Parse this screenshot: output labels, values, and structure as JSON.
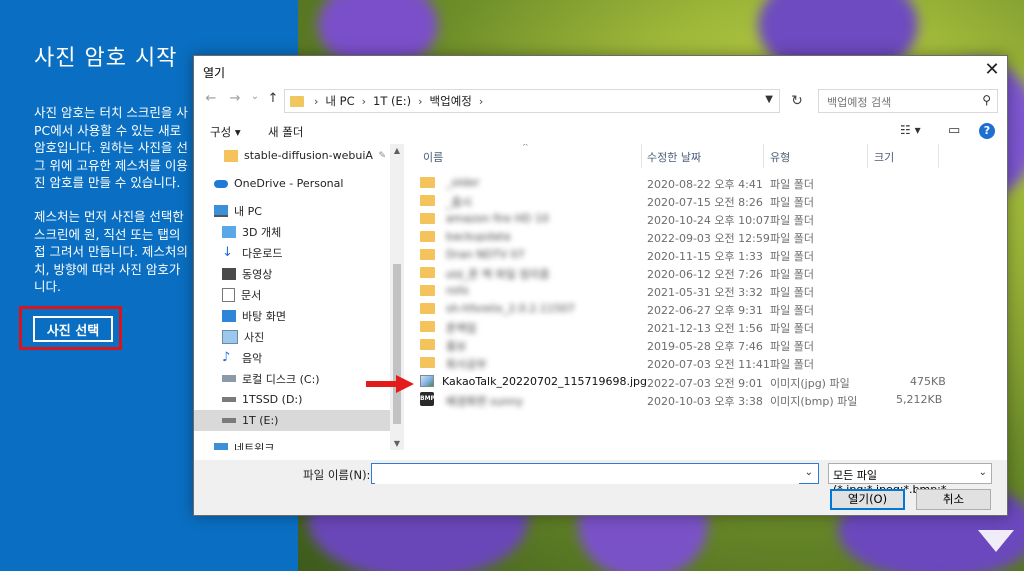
{
  "left_panel": {
    "title": "사진 암호 시작",
    "para1": "사진 암호는 터치 스크린을 사\nPC에서 사용할 수 있는 새로\n암호입니다. 원하는 사진을 선\n그 위에 고유한 제스처를 이용\n진 암호를 만들 수 있습니다.",
    "para2": "제스처는 먼저 사진을 선택한\n스크린에 원, 직선 또는 탭의\n접 그려서 만듭니다. 제스처의\n치, 방향에 따라 사진 암호가\n니다.",
    "button_label": "사진 선택"
  },
  "dialog": {
    "title": "열기",
    "close_symbol": "✕",
    "nav": {
      "back": "←",
      "forward": "→",
      "recent": "⌄",
      "up": "↑"
    },
    "breadcrumbs": [
      "내 PC",
      "1T (E:)",
      "백업예정"
    ],
    "breadcrumb_sep": "›",
    "refresh_symbol": "↻",
    "search_placeholder": "백업예정 검색",
    "toolbar": {
      "organize": "구성 ▾",
      "new_folder": "새 폴더",
      "view_symbol": "☷ ▾",
      "pane_symbol": "▭",
      "help": "?"
    },
    "nav_pane": [
      {
        "label": "stable-diffusion-webuiA",
        "icon": "folder-icon",
        "pin": "📌"
      },
      {
        "label": "OneDrive - Personal",
        "icon": "cloud-icon"
      },
      {
        "label": "내 PC",
        "icon": "pc-icon"
      },
      {
        "label": "3D 개체",
        "icon": "cube-icon"
      },
      {
        "label": "다운로드",
        "icon": "download-icon"
      },
      {
        "label": "동영상",
        "icon": "video-icon"
      },
      {
        "label": "문서",
        "icon": "document-icon"
      },
      {
        "label": "바탕 화면",
        "icon": "desktop-icon"
      },
      {
        "label": "사진",
        "icon": "picture-icon"
      },
      {
        "label": "음악",
        "icon": "music-icon"
      },
      {
        "label": "로컬 디스크 (C:)",
        "icon": "drive-icon"
      },
      {
        "label": "1TSSD (D:)",
        "icon": "drive-icon"
      },
      {
        "label": "1T (E:)",
        "icon": "drive-icon",
        "selected": true
      },
      {
        "label": "네트워크",
        "icon": "network-icon"
      }
    ],
    "columns": {
      "name": "이름",
      "date": "수정한 날짜",
      "type": "유형",
      "size": "크기"
    },
    "files": [
      {
        "name": "_older",
        "date": "2020-08-22 오후 4:41",
        "type": "파일 폴더",
        "size": "",
        "kind": "folder",
        "blurred": true
      },
      {
        "name": "_줌시",
        "date": "2020-07-15 오전 8:26",
        "type": "파일 폴더",
        "size": "",
        "kind": "folder",
        "blurred": true
      },
      {
        "name": "amazon fire HD 10",
        "date": "2020-10-24 오후 10:07",
        "type": "파일 폴더",
        "size": "",
        "kind": "folder",
        "blurred": true
      },
      {
        "name": "backupdata",
        "date": "2022-09-03 오전 12:59",
        "type": "파일 폴더",
        "size": "",
        "kind": "folder",
        "blurred": true
      },
      {
        "name": "Dran NDTV 07",
        "date": "2020-11-15 오후 1:33",
        "type": "파일 폴더",
        "size": "",
        "kind": "folder",
        "blurred": true
      },
      {
        "name": "old_폰 백 파일 정리중",
        "date": "2020-06-12 오전 7:26",
        "type": "파일 폴더",
        "size": "",
        "kind": "folder",
        "blurred": true
      },
      {
        "name": "rolls",
        "date": "2021-05-31 오전 3:32",
        "type": "파일 폴더",
        "size": "",
        "kind": "folder",
        "blurred": true
      },
      {
        "name": "sh-hfsrelix_2.0.2.11507",
        "date": "2022-06-27 오후 9:31",
        "type": "파일 폴더",
        "size": "",
        "kind": "folder",
        "blurred": true
      },
      {
        "name": "폰백업",
        "date": "2021-12-13 오전 1:56",
        "type": "파일 폴더",
        "size": "",
        "kind": "folder",
        "blurred": true
      },
      {
        "name": "홍보",
        "date": "2019-05-28 오후 7:46",
        "type": "파일 폴더",
        "size": "",
        "kind": "folder",
        "blurred": true
      },
      {
        "name": "회사공부",
        "date": "2020-07-03 오전 11:41",
        "type": "파일 폴더",
        "size": "",
        "kind": "folder",
        "blurred": true
      },
      {
        "name": "KakaoTalk_20220702_115719698.jpg",
        "date": "2022-07-03 오전 9:01",
        "type": "이미지(jpg) 파일",
        "size": "475KB",
        "kind": "jpg",
        "blurred": false
      },
      {
        "name": "배경화면 sunny",
        "date": "2020-10-03 오후 3:38",
        "type": "이미지(bmp) 파일",
        "size": "5,212KB",
        "kind": "bmp",
        "blurred": true
      }
    ],
    "filename_label": "파일 이름(N):",
    "filename_value": "",
    "filter_label": "모든 파일 (*.jpg;*.jpeg;*.bmp;*",
    "open_button": "열기(O)",
    "cancel_button": "취소"
  },
  "colors": {
    "panel_blue": "#0a6fc2",
    "highlight_red": "#d9141b",
    "accent_blue": "#0078d7"
  }
}
